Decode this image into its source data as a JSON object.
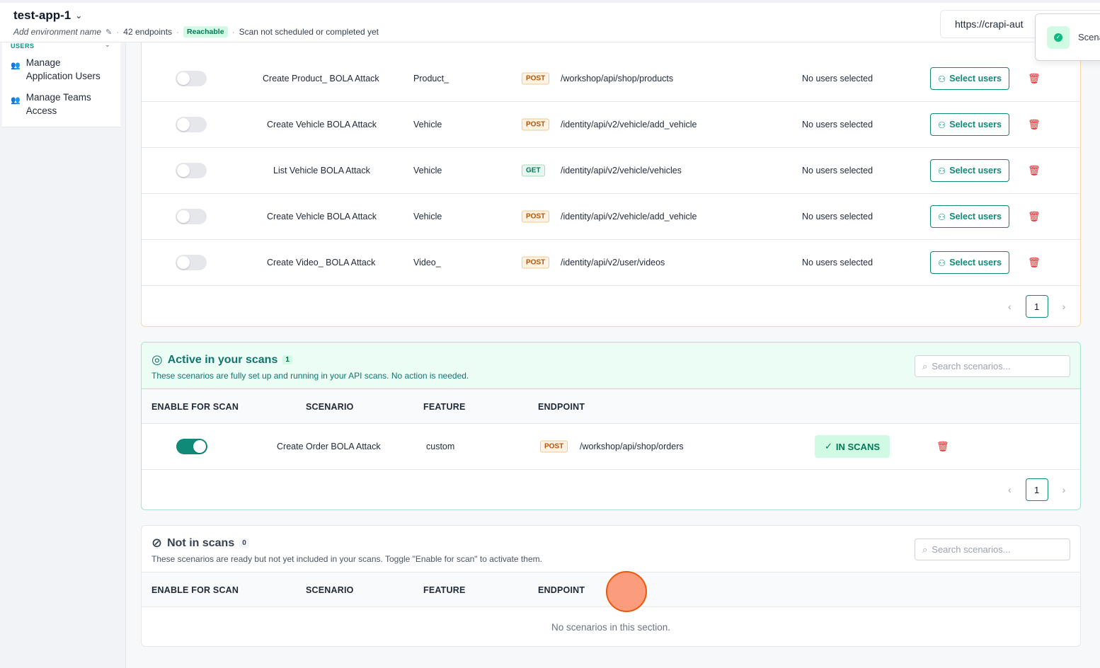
{
  "header": {
    "app_name": "test-app-1",
    "env_placeholder": "Add environment name",
    "endpoints": "42 endpoints",
    "reachable": "Reachable",
    "scan_status": "Scan not scheduled or completed yet",
    "url": "https://crapi-aut"
  },
  "toast": {
    "text": "Scena"
  },
  "sidebar": {
    "section": "USERS",
    "items": [
      {
        "label1": "Manage",
        "label2": "Application Users"
      },
      {
        "label1": "Manage Teams",
        "label2": "Access"
      }
    ]
  },
  "pending_rows": [
    {
      "scenario": "Create Product_ BOLA Attack",
      "feature": "Product_",
      "method": "POST",
      "endpoint": "/workshop/api/shop/products",
      "users": "No users selected",
      "button": "Select users"
    },
    {
      "scenario": "Create Vehicle BOLA Attack",
      "feature": "Vehicle",
      "method": "POST",
      "endpoint": "/identity/api/v2/vehicle/add_vehicle",
      "users": "No users selected",
      "button": "Select users"
    },
    {
      "scenario": "List Vehicle BOLA Attack",
      "feature": "Vehicle",
      "method": "GET",
      "endpoint": "/identity/api/v2/vehicle/vehicles",
      "users": "No users selected",
      "button": "Select users"
    },
    {
      "scenario": "Create Vehicle BOLA Attack",
      "feature": "Vehicle",
      "method": "POST",
      "endpoint": "/identity/api/v2/vehicle/add_vehicle",
      "users": "No users selected",
      "button": "Select users"
    },
    {
      "scenario": "Create Video_ BOLA Attack",
      "feature": "Video_",
      "method": "POST",
      "endpoint": "/identity/api/v2/user/videos",
      "users": "No users selected",
      "button": "Select users"
    }
  ],
  "pagination": {
    "page": "1",
    "prev": "‹",
    "next": "›"
  },
  "active": {
    "title": "Active in your scans",
    "count": "1",
    "description": "These scenarios are fully set up and running in your API scans. No action is needed.",
    "search_placeholder": "Search scenarios...",
    "columns": [
      "ENABLE FOR SCAN",
      "SCENARIO",
      "FEATURE",
      "ENDPOINT"
    ],
    "rows": [
      {
        "scenario": "Create Order BOLA Attack",
        "feature": "custom",
        "method": "POST",
        "endpoint": "/workshop/api/shop/orders",
        "status": "IN SCANS"
      }
    ]
  },
  "not_in_scans": {
    "title": "Not in scans",
    "count": "0",
    "description": "These scenarios are ready but not yet included in your scans. Toggle \"Enable for scan\" to activate them.",
    "search_placeholder": "Search scenarios...",
    "columns": [
      "ENABLE FOR SCAN",
      "SCENARIO",
      "FEATURE",
      "ENDPOINT"
    ],
    "empty": "No scenarios in this section."
  },
  "colors": {
    "accent": "#0f8a78",
    "post": "#b45309",
    "get": "#047857",
    "danger": "#dc2626"
  }
}
